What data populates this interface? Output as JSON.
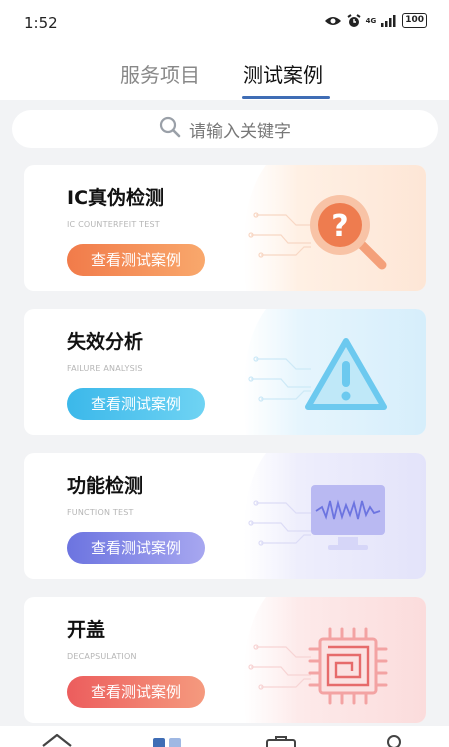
{
  "status": {
    "time": "1:52",
    "battery": "100",
    "network": "4G"
  },
  "tabs": [
    {
      "label": "服务项目"
    },
    {
      "label": "测试案例"
    }
  ],
  "search": {
    "placeholder": "请输入关键字"
  },
  "cards": [
    {
      "title": "IC真伪检测",
      "subtitle": "IC COUNTERFEIT TEST",
      "button": "查看测试案例",
      "icon": "question-magnifier-icon",
      "accent": "#f17b4a"
    },
    {
      "title": "失效分析",
      "subtitle": "FAILURE ANALYSIS",
      "button": "查看测试案例",
      "icon": "warning-triangle-icon",
      "accent": "#3bb8ea"
    },
    {
      "title": "功能检测",
      "subtitle": "FUNCTION TEST",
      "button": "查看测试案例",
      "icon": "waveform-monitor-icon",
      "accent": "#6c74e0"
    },
    {
      "title": "开盖",
      "subtitle": "DECAPSULATION",
      "button": "查看测试案例",
      "icon": "chip-maze-icon",
      "accent": "#ec5d5d"
    }
  ],
  "bottom_nav": [
    {
      "icon": "home-icon"
    },
    {
      "icon": "grid-icon"
    },
    {
      "icon": "briefcase-icon"
    },
    {
      "icon": "profile-icon"
    }
  ]
}
